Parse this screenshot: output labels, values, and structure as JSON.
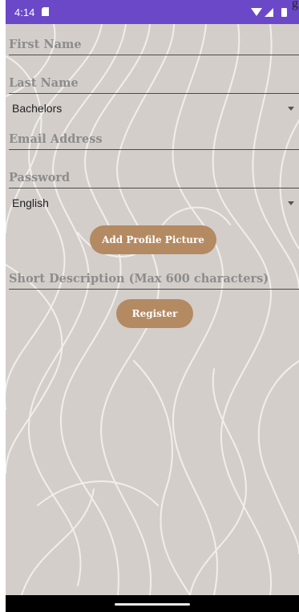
{
  "status_bar": {
    "time": "4:14",
    "icons": [
      "sd-card-icon",
      "wifi-icon",
      "signal-icon",
      "battery-icon"
    ],
    "color": "#6a48c8"
  },
  "edge_text": "g",
  "form": {
    "first_name_hint": "First Name",
    "last_name_hint": "Last Name",
    "degree_selected": "Bachelors",
    "email_hint": "Email Address",
    "password_hint": "Password",
    "language_selected": "English",
    "add_picture_label": "Add Profile Picture",
    "description_hint": "Short Description (Max 600 characters)",
    "register_label": "Register"
  },
  "colors": {
    "background": "#d4ceca",
    "button": "#b48a63",
    "hint_text": "#8c8c8c"
  }
}
